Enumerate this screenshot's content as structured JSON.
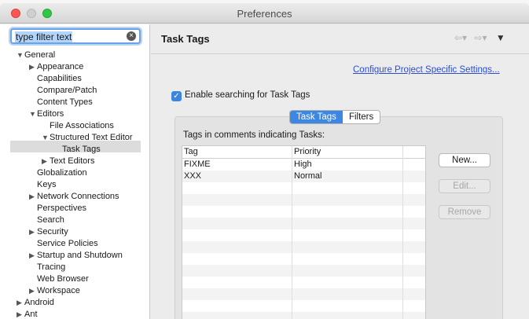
{
  "window": {
    "title": "Preferences"
  },
  "filter": {
    "value": "type filter text",
    "clear_icon": "clear-icon"
  },
  "tree": [
    {
      "label": "General",
      "indent": 0,
      "expanded": true
    },
    {
      "label": "Appearance",
      "indent": 1,
      "expanded": false
    },
    {
      "label": "Capabilities",
      "indent": 1
    },
    {
      "label": "Compare/Patch",
      "indent": 1
    },
    {
      "label": "Content Types",
      "indent": 1
    },
    {
      "label": "Editors",
      "indent": 1,
      "expanded": true
    },
    {
      "label": "File Associations",
      "indent": 2
    },
    {
      "label": "Structured Text Editor",
      "indent": 2,
      "expanded": true
    },
    {
      "label": "Task Tags",
      "indent": 3,
      "selected": true
    },
    {
      "label": "Text Editors",
      "indent": 2,
      "expanded": false
    },
    {
      "label": "Globalization",
      "indent": 1
    },
    {
      "label": "Keys",
      "indent": 1
    },
    {
      "label": "Network Connections",
      "indent": 1,
      "expanded": false
    },
    {
      "label": "Perspectives",
      "indent": 1
    },
    {
      "label": "Search",
      "indent": 1
    },
    {
      "label": "Security",
      "indent": 1,
      "expanded": false
    },
    {
      "label": "Service Policies",
      "indent": 1
    },
    {
      "label": "Startup and Shutdown",
      "indent": 1,
      "expanded": false
    },
    {
      "label": "Tracing",
      "indent": 1
    },
    {
      "label": "Web Browser",
      "indent": 1
    },
    {
      "label": "Workspace",
      "indent": 1,
      "expanded": false
    },
    {
      "label": "Android",
      "indent": 0,
      "expanded": false
    },
    {
      "label": "Ant",
      "indent": 0,
      "expanded": false
    }
  ],
  "page": {
    "title": "Task Tags",
    "configure_link": "Configure Project Specific Settings...",
    "enable_checkbox": {
      "label": "Enable searching for Task Tags",
      "checked": true
    },
    "tabs": [
      {
        "label": "Task Tags",
        "active": true
      },
      {
        "label": "Filters",
        "active": false
      }
    ],
    "group_label": "Tags in comments indicating Tasks:",
    "table": {
      "columns": [
        "Tag",
        "Priority"
      ],
      "rows": [
        {
          "tag": "FIXME",
          "priority": "High"
        },
        {
          "tag": "XXX",
          "priority": "Normal"
        }
      ]
    },
    "buttons": {
      "new": "New...",
      "edit": "Edit...",
      "remove": "Remove"
    }
  },
  "colors": {
    "accent": "#3b87e3",
    "link": "#2a4fd6",
    "selection": "#dcdcdc"
  }
}
